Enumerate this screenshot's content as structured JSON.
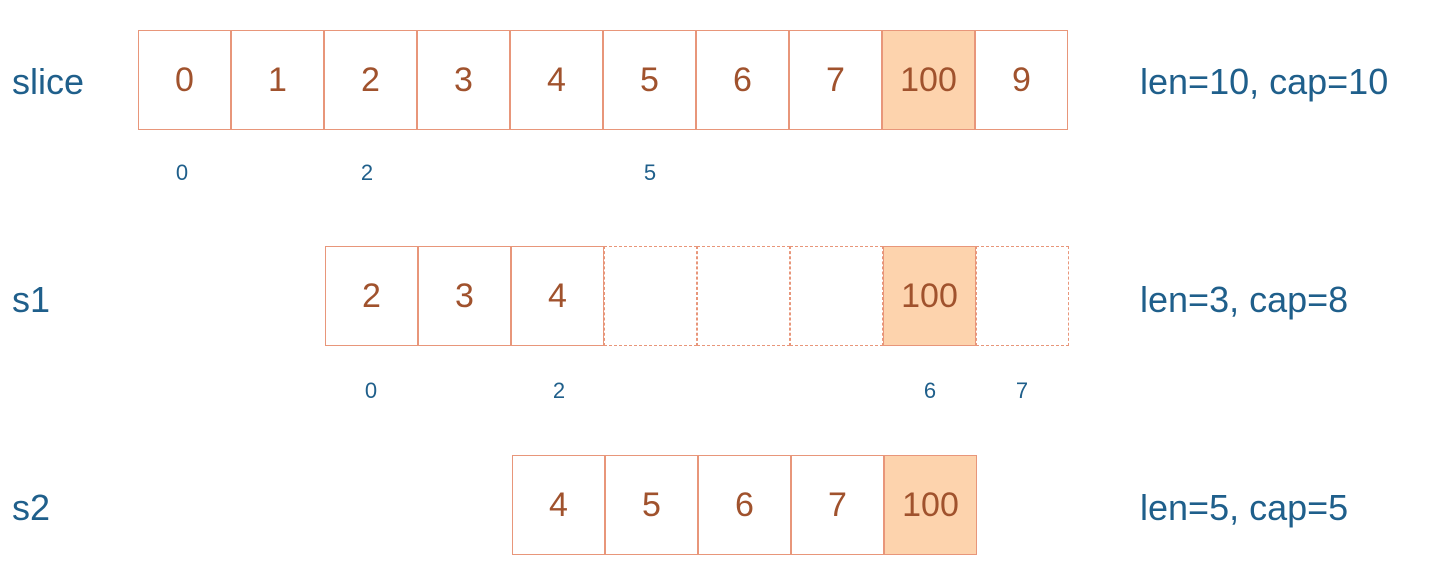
{
  "colors": {
    "label_blue": "#1f5f8b",
    "cell_border": "#e8967a",
    "value_brown": "#a0522d",
    "highlight_fill": "#fdd3ad"
  },
  "rows": [
    {
      "label": "slice",
      "info": "len=10, cap=10",
      "cells": [
        {
          "value": "0",
          "highlight": false,
          "dashed": false
        },
        {
          "value": "1",
          "highlight": false,
          "dashed": false
        },
        {
          "value": "2",
          "highlight": false,
          "dashed": false
        },
        {
          "value": "3",
          "highlight": false,
          "dashed": false
        },
        {
          "value": "4",
          "highlight": false,
          "dashed": false
        },
        {
          "value": "5",
          "highlight": false,
          "dashed": false
        },
        {
          "value": "6",
          "highlight": false,
          "dashed": false
        },
        {
          "value": "7",
          "highlight": false,
          "dashed": false
        },
        {
          "value": "100",
          "highlight": true,
          "dashed": false
        },
        {
          "value": "9",
          "highlight": false,
          "dashed": false
        }
      ],
      "indices": [
        "0",
        "2",
        "5"
      ]
    },
    {
      "label": "s1",
      "info": "len=3, cap=8",
      "cells": [
        {
          "value": "2",
          "highlight": false,
          "dashed": false
        },
        {
          "value": "3",
          "highlight": false,
          "dashed": false
        },
        {
          "value": "4",
          "highlight": false,
          "dashed": false
        },
        {
          "value": "",
          "highlight": false,
          "dashed": true
        },
        {
          "value": "",
          "highlight": false,
          "dashed": true
        },
        {
          "value": "",
          "highlight": false,
          "dashed": true
        },
        {
          "value": "100",
          "highlight": true,
          "dashed": false
        },
        {
          "value": "",
          "highlight": false,
          "dashed": true
        }
      ],
      "indices": [
        "0",
        "2",
        "6",
        "7"
      ]
    },
    {
      "label": "s2",
      "info": "len=5, cap=5",
      "cells": [
        {
          "value": "4",
          "highlight": false,
          "dashed": false
        },
        {
          "value": "5",
          "highlight": false,
          "dashed": false
        },
        {
          "value": "6",
          "highlight": false,
          "dashed": false
        },
        {
          "value": "7",
          "highlight": false,
          "dashed": false
        },
        {
          "value": "100",
          "highlight": true,
          "dashed": false
        }
      ],
      "indices": []
    }
  ]
}
